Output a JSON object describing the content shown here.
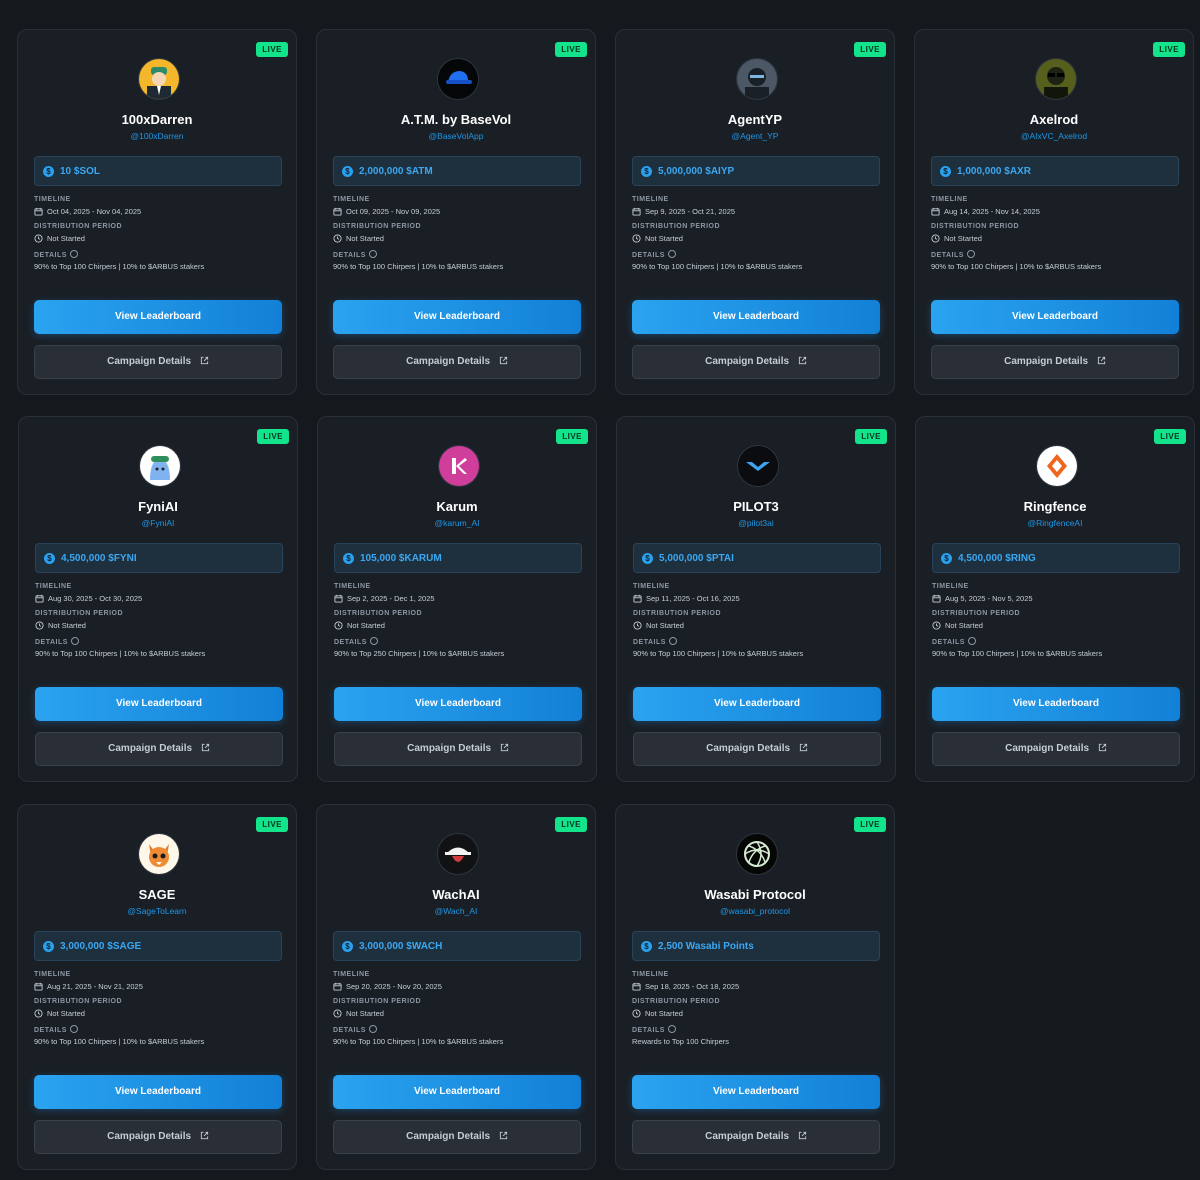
{
  "labels": {
    "live": "LIVE",
    "timeline": "TIMELINE",
    "distribution": "DISTRIBUTION PERIOD",
    "details": "DETAILS",
    "view_leaderboard": "View Leaderboard",
    "campaign_details": "Campaign Details"
  },
  "colors": {
    "background": "#15191e",
    "card": "#1a1f25",
    "live_badge": "#13e38a",
    "accent_blue": "#1e97e8",
    "reward_text": "#3aa8f2"
  },
  "cards": [
    {
      "name": "100xDarren",
      "handle": "@100xDarren",
      "reward": "10 $SOL",
      "timeline": "Oct 04, 2025 - Nov 04, 2025",
      "distribution": "Not Started",
      "details": "90% to Top 100 Chirpers | 10% to $ARBUS stakers",
      "avatar_icon": "cartoon-man-avatar-icon"
    },
    {
      "name": "A.T.M. by BaseVol",
      "handle": "@BaseVolApp",
      "reward": "2,000,000 $ATM",
      "timeline": "Oct 09, 2025 - Nov 09, 2025",
      "distribution": "Not Started",
      "details": "90% to Top 100 Chirpers | 10% to $ARBUS stakers",
      "avatar_icon": "blue-cap-avatar-icon"
    },
    {
      "name": "AgentYP",
      "handle": "@Agent_YP",
      "reward": "5,000,000 $AIYP",
      "timeline": "Sep 9, 2025 - Oct 21, 2025",
      "distribution": "Not Started",
      "details": "90% to Top 100 Chirpers | 10% to $ARBUS stakers",
      "avatar_icon": "masked-agent-avatar-icon"
    },
    {
      "name": "Axelrod",
      "handle": "@AIxVC_Axelrod",
      "reward": "1,000,000 $AXR",
      "timeline": "Aug 14, 2025 - Nov 14, 2025",
      "distribution": "Not Started",
      "details": "90% to Top 100 Chirpers | 10% to $ARBUS stakers",
      "avatar_icon": "sunglasses-avatar-icon"
    },
    {
      "name": "FyniAI",
      "handle": "@FyniAI",
      "reward": "4,500,000 $FYNI",
      "timeline": "Aug 30, 2025 - Oct 30, 2025",
      "distribution": "Not Started",
      "details": "90% to Top 100 Chirpers | 10% to $ARBUS stakers",
      "avatar_icon": "blue-blob-mascot-icon"
    },
    {
      "name": "Karum",
      "handle": "@karum_AI",
      "reward": "105,000 $KARUM",
      "timeline": "Sep 2, 2025 - Dec 1, 2025",
      "distribution": "Not Started",
      "details": "90% to Top 250 Chirpers | 10% to $ARBUS stakers",
      "avatar_icon": "pink-k-logo-icon"
    },
    {
      "name": "PILOT3",
      "handle": "@pilot3ai",
      "reward": "5,000,000 $PTAI",
      "timeline": "Sep 11, 2025 - Oct 16, 2025",
      "distribution": "Not Started",
      "details": "90% to Top 100 Chirpers | 10% to $ARBUS stakers",
      "avatar_icon": "blue-wings-logo-icon"
    },
    {
      "name": "Ringfence",
      "handle": "@RingfenceAI",
      "reward": "4,500,000 $RING",
      "timeline": "Aug 5, 2025 - Nov 5, 2025",
      "distribution": "Not Started",
      "details": "90% to Top 100 Chirpers | 10% to $ARBUS stakers",
      "avatar_icon": "orange-diamond-logo-icon"
    },
    {
      "name": "SAGE",
      "handle": "@SageToLearn",
      "reward": "3,000,000 $SAGE",
      "timeline": "Aug 21, 2025 - Nov 21, 2025",
      "distribution": "Not Started",
      "details": "90% to Top 100 Chirpers | 10% to $ARBUS stakers",
      "avatar_icon": "fox-avatar-icon"
    },
    {
      "name": "WachAI",
      "handle": "@Wach_AI",
      "reward": "3,000,000 $WACH",
      "timeline": "Sep 20, 2025 - Nov 20, 2025",
      "distribution": "Not Started",
      "details": "90% to Top 100 Chirpers | 10% to $ARBUS stakers",
      "avatar_icon": "spy-hat-avatar-icon"
    },
    {
      "name": "Wasabi Protocol",
      "handle": "@wasabi_protocol",
      "reward": "2,500 Wasabi Points",
      "timeline": "Sep 18, 2025 - Oct 18, 2025",
      "distribution": "Not Started",
      "details": "Rewards to Top 100 Chirpers",
      "avatar_icon": "swirl-logo-icon"
    }
  ]
}
